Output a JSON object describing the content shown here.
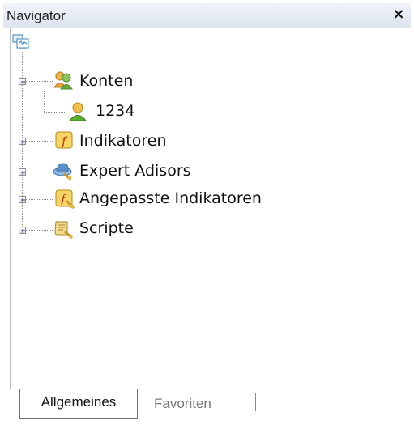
{
  "window": {
    "title": "Navigator",
    "close_label": "×"
  },
  "tree": {
    "root_icon": "terminal-icon",
    "items": [
      {
        "label": "Konten",
        "icon": "accounts-icon",
        "expander": "minus"
      },
      {
        "label": "1234",
        "icon": "user-account-icon"
      },
      {
        "label": "Indikatoren",
        "icon": "indicator-icon",
        "expander": "plus"
      },
      {
        "label": "Expert Adisors",
        "icon": "expert-advisor-icon",
        "expander": "plus"
      },
      {
        "label": "Angepasste Indikatoren",
        "icon": "custom-indicator-icon",
        "expander": "plus"
      },
      {
        "label": "Scripte",
        "icon": "script-icon",
        "expander": "plus"
      }
    ]
  },
  "tabs": [
    {
      "label": "Allgemeines",
      "active": true
    },
    {
      "label": "Favoriten",
      "active": false
    }
  ]
}
